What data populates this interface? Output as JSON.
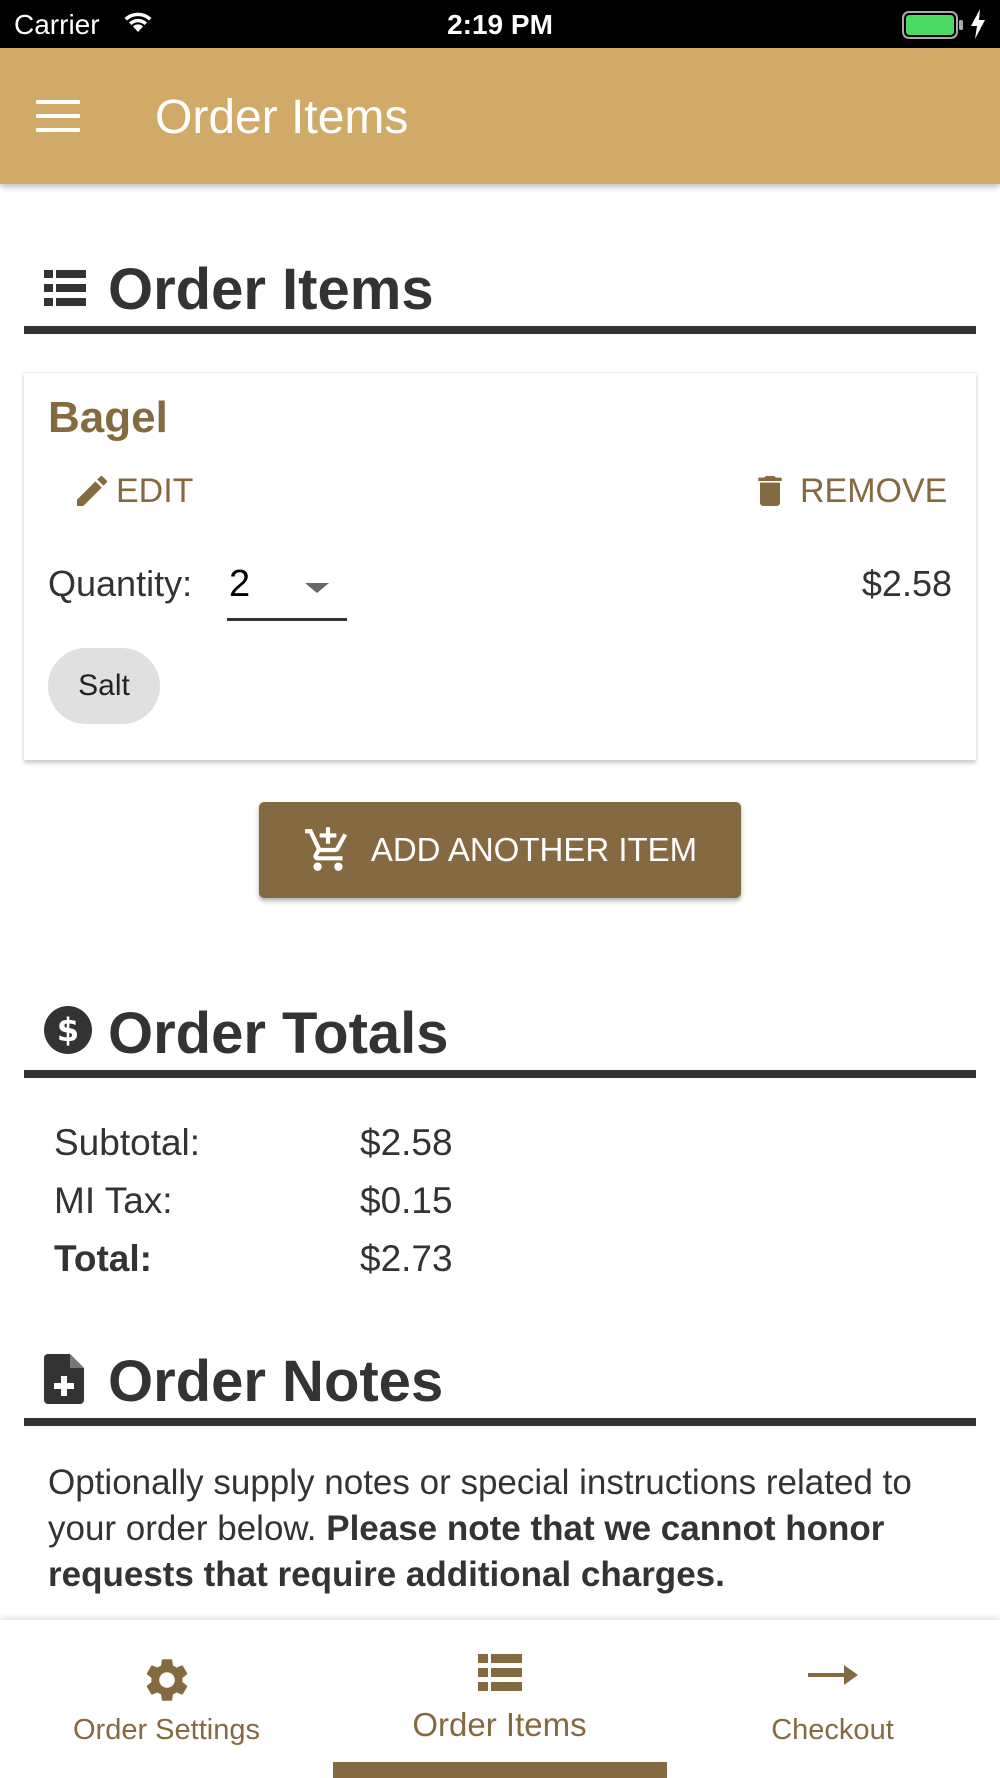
{
  "status_bar": {
    "carrier": "Carrier",
    "time": "2:19 PM"
  },
  "app_bar": {
    "title": "Order Items"
  },
  "items_section": {
    "title": "Order Items"
  },
  "item": {
    "name": "Bagel",
    "edit_label": "EDIT",
    "remove_label": "REMOVE",
    "quantity_label": "Quantity:",
    "quantity_value": "2",
    "price": "$2.58",
    "modifiers": [
      "Salt"
    ]
  },
  "add_button": {
    "label": "ADD ANOTHER ITEM"
  },
  "totals_section": {
    "title": "Order Totals",
    "rows": [
      {
        "label": "Subtotal:",
        "value": "$2.58"
      },
      {
        "label": "MI Tax:",
        "value": "$0.15"
      },
      {
        "label": "Total:",
        "value": "$2.73"
      }
    ]
  },
  "notes_section": {
    "title": "Order Notes",
    "text": "Optionally supply notes or special instructions related to your order below.",
    "text_bold": "Please note that we cannot honor requests that require additional charges."
  },
  "bottom_nav": {
    "items": [
      {
        "label": "Order Settings",
        "icon": "gear-icon"
      },
      {
        "label": "Order Items",
        "icon": "list-icon",
        "active": true
      },
      {
        "label": "Checkout",
        "icon": "arrow-right-icon"
      }
    ]
  },
  "colors": {
    "app_bar": "#d2aa67",
    "accent": "#856a41",
    "heading": "#333333",
    "battery": "#4cd964"
  }
}
